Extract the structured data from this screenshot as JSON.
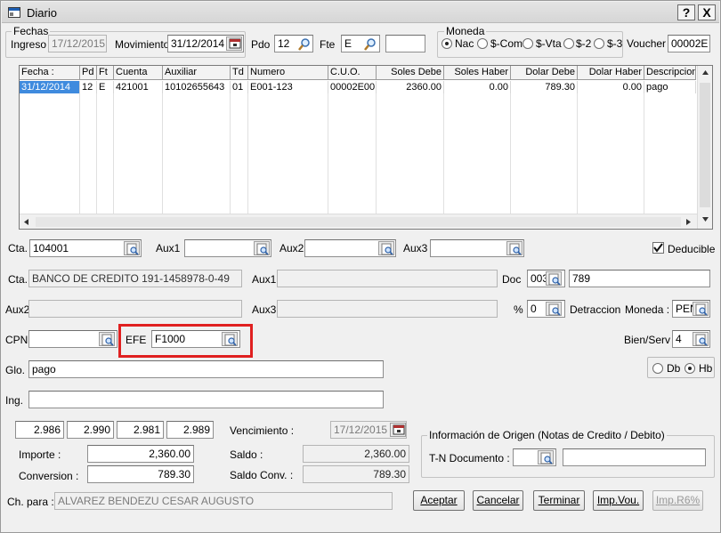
{
  "window": {
    "title": "Diario",
    "help_label": "?",
    "close_label": "X"
  },
  "fechas": {
    "group_label": "Fechas",
    "ingreso_label": "Ingreso",
    "ingreso_value": "17/12/2015",
    "movimiento_label": "Movimiento",
    "movimiento_value": "31/12/2014",
    "pdo_label": "Pdo",
    "pdo_value": "12",
    "fte_label": "Fte",
    "fte_value": "E"
  },
  "moneda": {
    "group_label": "Moneda",
    "options": [
      "Nac",
      "$-Com",
      "$-Vta",
      "$-2",
      "$-3"
    ],
    "selected": "Nac"
  },
  "voucher": {
    "label": "Voucher",
    "value": "00002E"
  },
  "grid": {
    "columns": [
      "Fecha :",
      "Pd",
      "Ft",
      "Cuenta",
      "Auxiliar",
      "Td",
      "Numero",
      "C.U.O.",
      "Soles Debe",
      "Soles Haber",
      "Dolar Debe",
      "Dolar Haber",
      "Descripcion"
    ],
    "rows": [
      [
        "31/12/2014",
        "12",
        "E",
        "421001",
        "10102655643",
        "01",
        "E001-123",
        "00002E00",
        "2360.00",
        "0.00",
        "789.30",
        "0.00",
        "pago"
      ]
    ]
  },
  "form": {
    "cta_label": "Cta.",
    "cta_value": "104001",
    "aux1_label": "Aux1",
    "aux2_label": "Aux2",
    "aux3_label": "Aux3",
    "deducible_label": "Deducible",
    "deducible_checked": true,
    "cta_desc_label": "Cta.",
    "cta_desc_value": "BANCO DE CREDITO 191-1458978-0-49",
    "doc_label": "Doc",
    "doc_type": "003",
    "doc_value": "789",
    "percent_label": "%",
    "percent_value": "0",
    "detraccion_label": "Detraccion",
    "moneda_label": "Moneda :",
    "moneda_value": "PEN",
    "cpn_label": "CPN",
    "efe_label": "EFE",
    "efe_value": "F1000",
    "bienserv_label": "Bien/Serv",
    "bienserv_value": "4",
    "glo_label": "Glo.",
    "glo_value": "pago",
    "ing_label": "Ing.",
    "dbhb_options": [
      "Db",
      "Hb"
    ],
    "dbhb_selected": "Hb"
  },
  "rates": [
    "2.986",
    "2.990",
    "2.981",
    "2.989"
  ],
  "vencimiento": {
    "label": "Vencimiento :",
    "value": "17/12/2015"
  },
  "importe": {
    "label": "Importe :",
    "value": "2,360.00"
  },
  "conversion": {
    "label": "Conversion :",
    "value": "789.30"
  },
  "saldo": {
    "label": "Saldo :",
    "value": "2,360.00"
  },
  "saldo_conv": {
    "label": "Saldo Conv. :",
    "value": "789.30"
  },
  "origen": {
    "group_label": "Información de Origen (Notas de Credito / Debito)",
    "tn_label": "T-N Documento :"
  },
  "chpara": {
    "label": "Ch. para :",
    "value": "ALVAREZ BENDEZU CESAR AUGUSTO"
  },
  "buttons": {
    "aceptar": "Aceptar",
    "cancelar": "Cancelar",
    "terminar": "Terminar",
    "impvou": "Imp.Vou.",
    "impr6": "Imp.R6%"
  }
}
